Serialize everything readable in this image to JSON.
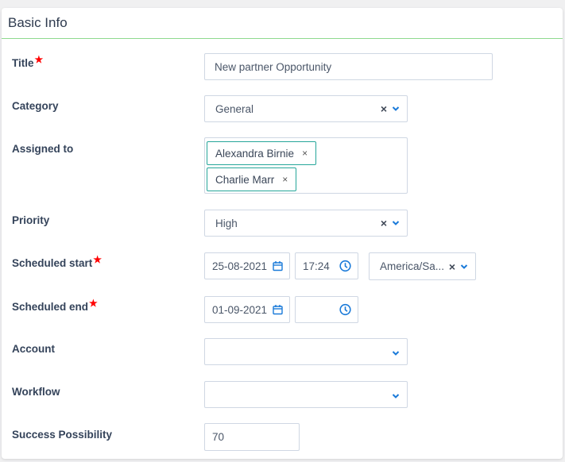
{
  "card": {
    "title": "Basic Info"
  },
  "fields": {
    "title": {
      "label": "Title",
      "required": true,
      "value": "New partner Opportunity"
    },
    "category": {
      "label": "Category",
      "value": "General"
    },
    "assigned_to": {
      "label": "Assigned to",
      "tags": [
        "Alexandra Birnie",
        "Charlie Marr"
      ]
    },
    "priority": {
      "label": "Priority",
      "value": "High"
    },
    "scheduled_start": {
      "label": "Scheduled start",
      "required": true,
      "date": "25-08-2021",
      "time": "17:24",
      "timezone": "America/Sa..."
    },
    "scheduled_end": {
      "label": "Scheduled end",
      "required": true,
      "date": "01-09-2021",
      "time": ""
    },
    "account": {
      "label": "Account",
      "value": ""
    },
    "workflow": {
      "label": "Workflow",
      "value": ""
    },
    "success_possibility": {
      "label": "Success Possibility",
      "value": "70"
    }
  },
  "symbols": {
    "required": "★",
    "clear": "×",
    "tag_remove": "×"
  },
  "colors": {
    "accent": "#1a7ad9",
    "required": "#ff0000",
    "tag_border": "#26a69a",
    "header_rule": "#8fd98f"
  }
}
